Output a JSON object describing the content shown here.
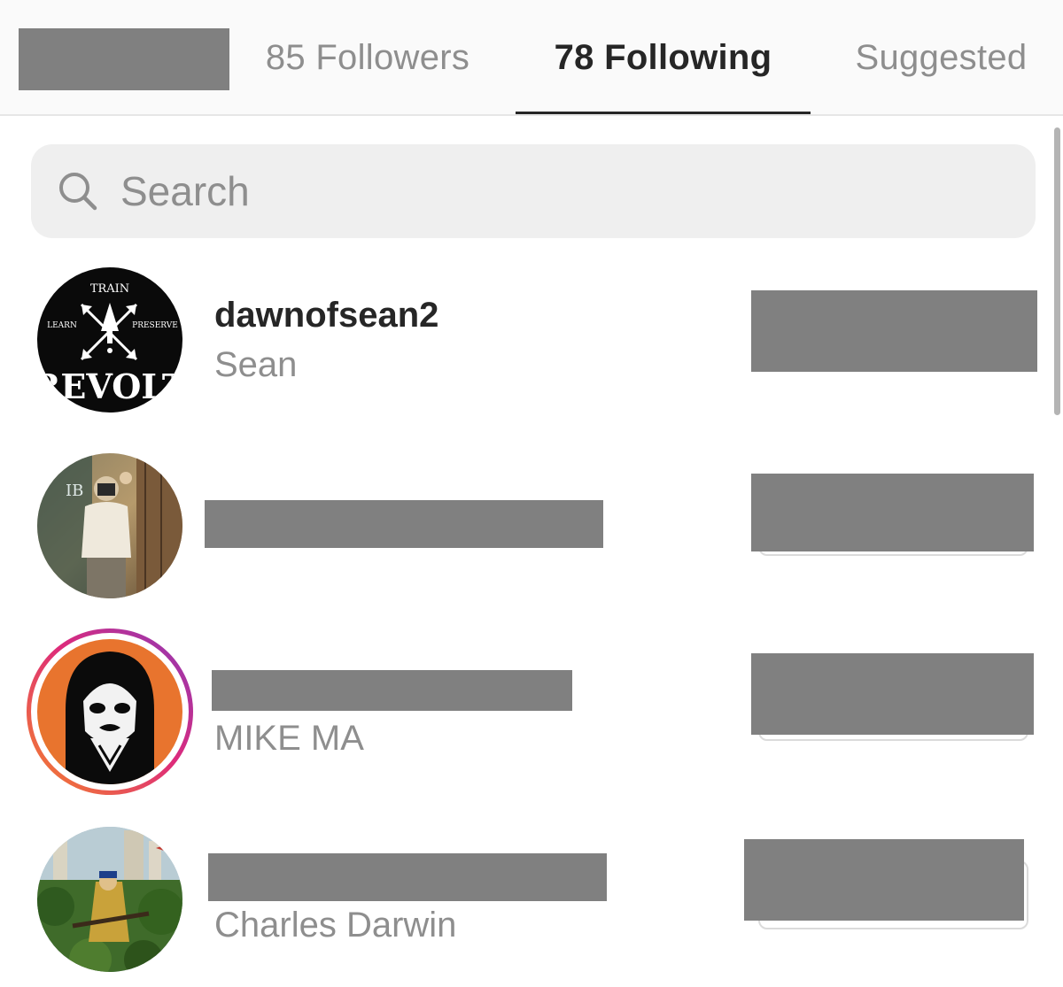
{
  "tabs": {
    "followers": "85 Followers",
    "following": "78 Following",
    "suggested": "Suggested"
  },
  "search": {
    "placeholder": "Search"
  },
  "accounts": [
    {
      "username": "dawnofsean2",
      "name": "Sean",
      "avatar_text": {
        "top": "TRAIN",
        "left": "LEARN",
        "right": "PRESERVE",
        "bottom": "REVOLT"
      }
    },
    {
      "username": "",
      "name": "",
      "avatar_text": {
        "sign": "IB"
      }
    },
    {
      "username": "",
      "name": "MIKE MA"
    },
    {
      "username": "",
      "name": "Charles Darwin"
    }
  ],
  "colors": {
    "active_tab": "#262626",
    "inactive_tab": "#8e8e8e",
    "redaction": "#808080",
    "story_ring_start": "#f58529",
    "story_ring_end": "#8a3ab9"
  }
}
